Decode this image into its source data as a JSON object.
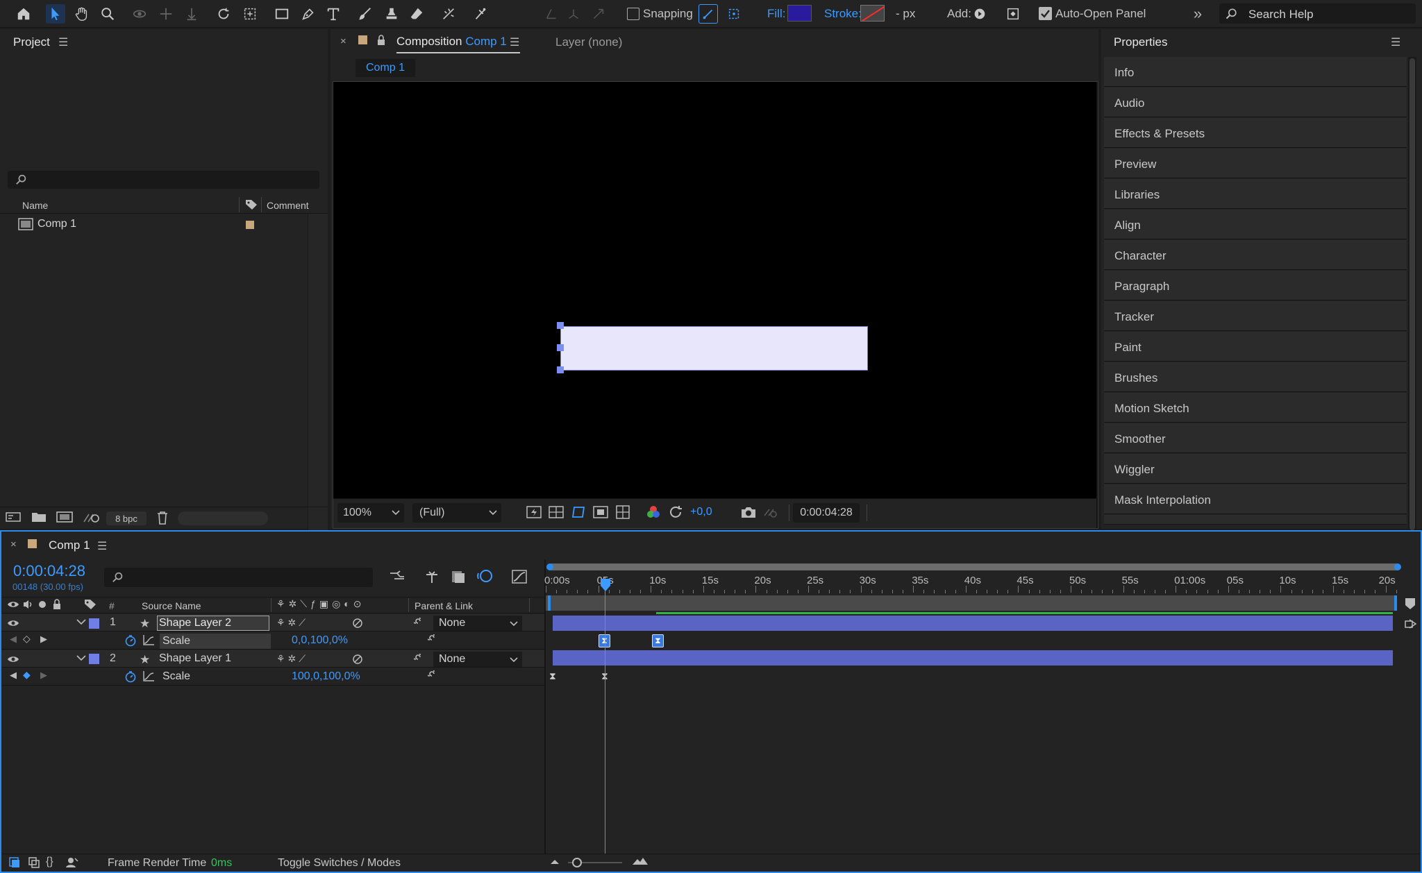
{
  "toolbar": {
    "snapping": "Snapping",
    "fill": "Fill:",
    "stroke": "Stroke:",
    "stroke_px": "- px",
    "add": "Add:",
    "auto_open": "Auto-Open Panel",
    "search_placeholder": "Search Help",
    "fill_color": "#2a1a9e"
  },
  "project": {
    "title": "Project",
    "columns": {
      "name": "Name",
      "comment": "Comment"
    },
    "items": [
      {
        "name": "Comp 1"
      }
    ],
    "bpc": "8 bpc"
  },
  "composition": {
    "tab_prefix": "Composition",
    "tab_name": "Comp 1",
    "layer_tab": "Layer (none)",
    "sub_tab": "Comp 1",
    "zoom": "100%",
    "resolution": "(Full)",
    "exposure": "+0,0",
    "timecode": "0:00:04:28"
  },
  "properties": {
    "title": "Properties",
    "items": [
      "Info",
      "Audio",
      "Effects & Presets",
      "Preview",
      "Libraries",
      "Align",
      "Character",
      "Paragraph",
      "Tracker",
      "Paint",
      "Brushes",
      "Motion Sketch",
      "Smoother",
      "Wiggler",
      "Mask Interpolation"
    ]
  },
  "timeline": {
    "tab": "Comp 1",
    "timecode": "0:00:04:28",
    "frames": "00148 (30.00 fps)",
    "col_source": "Source Name",
    "col_parent": "Parent & Link",
    "col_num": "#",
    "ticks": [
      "0:00s",
      "05s",
      "10s",
      "15s",
      "20s",
      "25s",
      "30s",
      "35s",
      "40s",
      "45s",
      "50s",
      "55s",
      "01:00s",
      "05s",
      "10s",
      "15s",
      "20s"
    ],
    "layers": [
      {
        "num": "1",
        "name": "Shape Layer 2",
        "parent": "None",
        "prop": "Scale",
        "value": "0,0,100,0%"
      },
      {
        "num": "2",
        "name": "Shape Layer 1",
        "parent": "None",
        "prop": "Scale",
        "value": "100,0,100,0%"
      }
    ],
    "footer": {
      "render_label": "Frame Render Time",
      "render_value": "0ms",
      "toggle": "Toggle Switches / Modes"
    }
  }
}
